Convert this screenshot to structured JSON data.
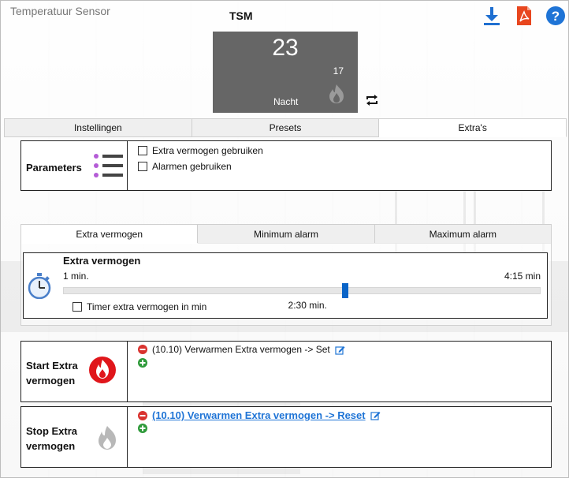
{
  "window": {
    "title": "Temperatuur Sensor",
    "device_name": "TSM"
  },
  "toolbar": {
    "icons": [
      "download-icon",
      "pdf-icon",
      "help-icon"
    ]
  },
  "tile": {
    "temperature": "23",
    "setpoint": "17",
    "mode": "Nacht",
    "background": "#666666"
  },
  "tabs": [
    {
      "label": "Instellingen",
      "active": false
    },
    {
      "label": "Presets",
      "active": false
    },
    {
      "label": "Extra's",
      "active": true
    }
  ],
  "parameters": {
    "label": "Parameters",
    "options": [
      {
        "label": "Extra vermogen gebruiken",
        "checked": false
      },
      {
        "label": "Alarmen gebruiken",
        "checked": false
      }
    ]
  },
  "subtabs": [
    {
      "label": "Extra vermogen",
      "active": true
    },
    {
      "label": "Minimum alarm",
      "active": false
    },
    {
      "label": "Maximum alarm",
      "active": false
    }
  ],
  "extra_vermogen": {
    "title": "Extra vermogen",
    "min_label": "1 min.",
    "max_label": "4:15 min",
    "current_label": "2:30 min.",
    "slider_fraction": 0.59,
    "timer_label": "Timer extra vermogen in min",
    "timer_checked": false
  },
  "start": {
    "label_line1": "Start Extra",
    "label_line2": "vermogen",
    "action_text": "(10.10) Verwarmen Extra vermogen -> Set",
    "icon_color": "#e0161b"
  },
  "stop": {
    "label_line1": "Stop Extra",
    "label_line2": "vermogen",
    "action_text": "(10.10) Verwarmen Extra vermogen -> Reset",
    "link_color": "#1f74d6"
  },
  "colors": {
    "accent": "#0a64c8",
    "minus": "#d9322e",
    "plus": "#2e9a3a"
  }
}
